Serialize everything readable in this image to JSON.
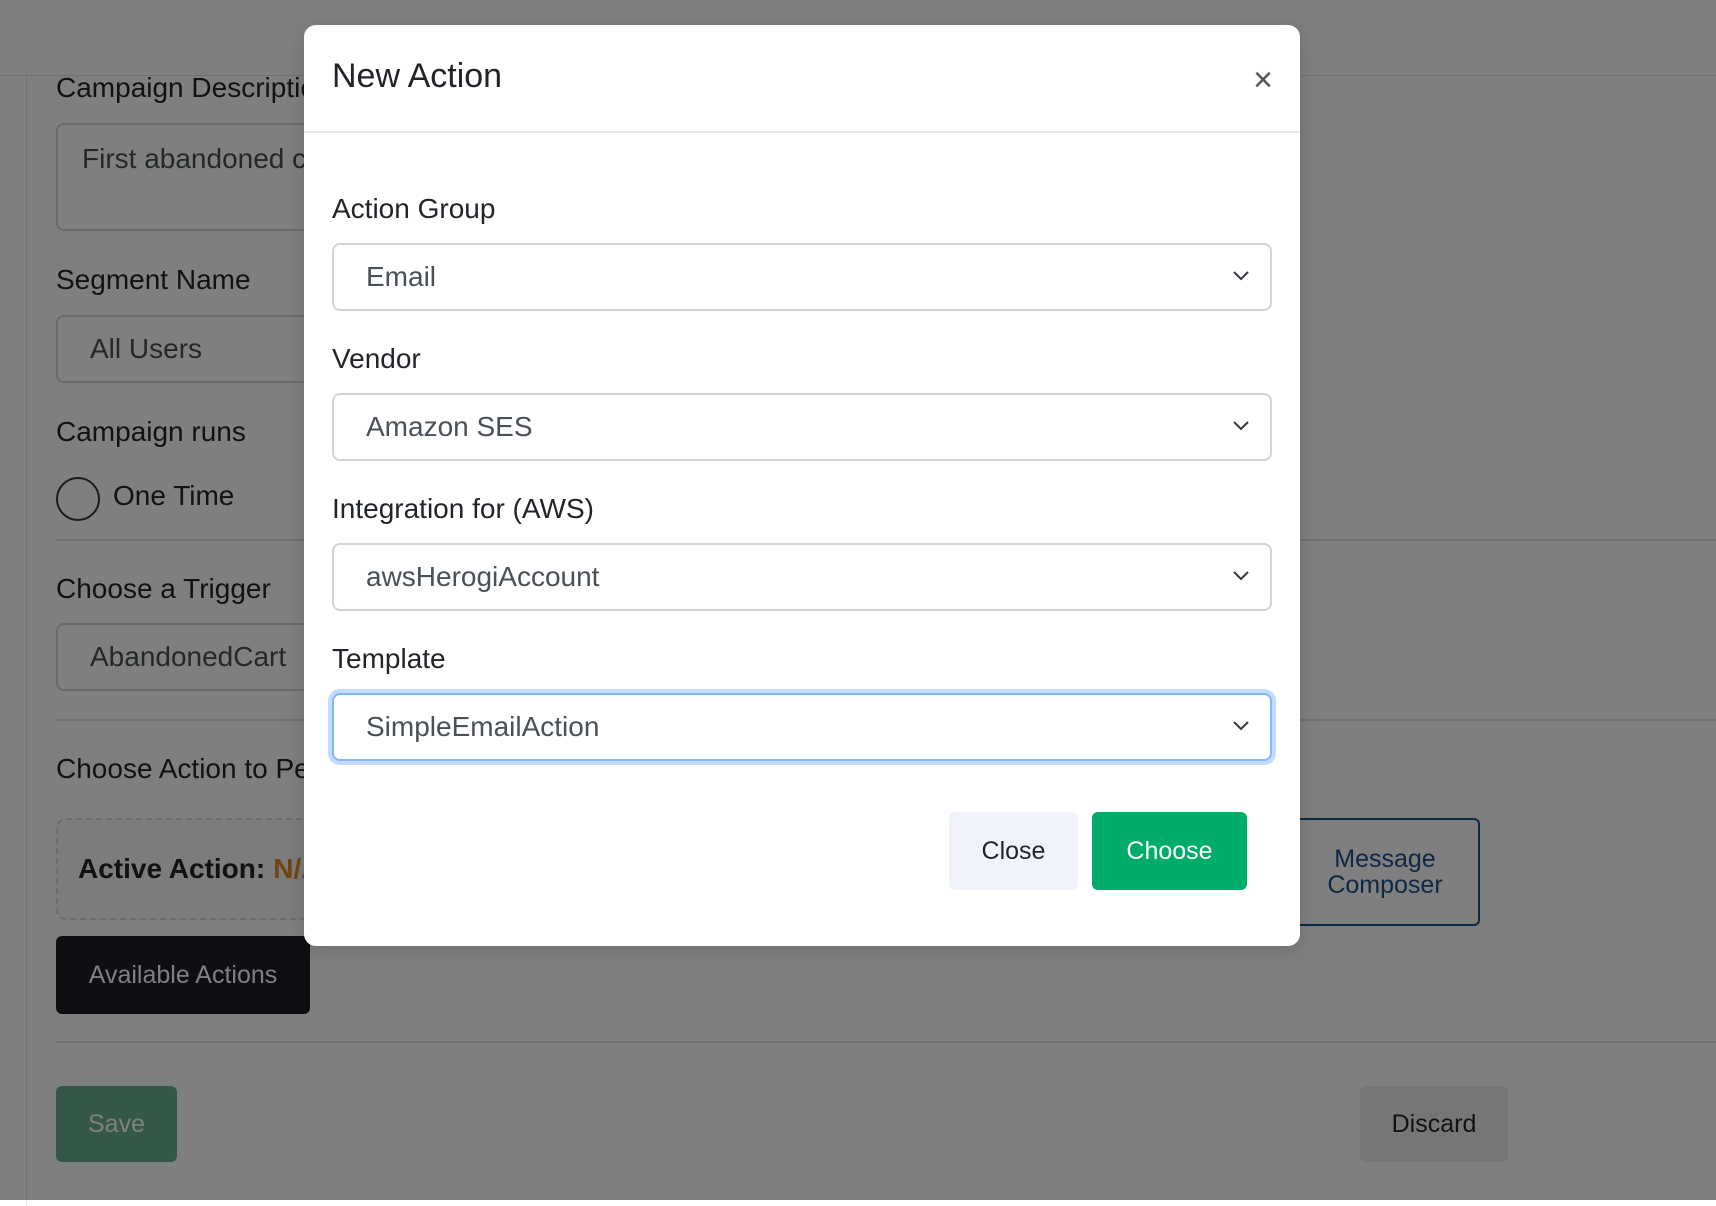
{
  "background_form": {
    "campaign_description_label": "Campaign Description",
    "campaign_description_value": "First abandoned cart",
    "segment_name_label": "Segment Name",
    "segment_name_value": "All Users",
    "campaign_runs_label": "Campaign runs",
    "one_time_label": "One Time",
    "choose_trigger_label": "Choose a Trigger",
    "trigger_value": "AbandonedCart",
    "choose_action_label": "Choose Action to Perform",
    "active_action_label": "Active Action:",
    "active_action_value": "N/A",
    "available_actions_label": "Available Actions",
    "message_composer_label": "Message Composer",
    "save_label": "Save",
    "discard_label": "Discard"
  },
  "modal": {
    "title": "New Action",
    "close_icon": "×",
    "action_group_label": "Action Group",
    "action_group_value": "Email",
    "vendor_label": "Vendor",
    "vendor_value": "Amazon SES",
    "integration_label": "Integration for (AWS)",
    "integration_value": "awsHerogiAccount",
    "template_label": "Template",
    "template_value": "SimpleEmailAction",
    "close_button": "Close",
    "choose_button": "Choose"
  },
  "colors": {
    "choose_button": "#00ac69",
    "active_action_value": "#e08a1e",
    "message_composer": "#1c4f8c",
    "focus_ring": "#86b7fe"
  },
  "icons": {
    "close": "close-icon",
    "dropdown": "chevron-down-icon",
    "radio": "radio-unchecked"
  }
}
